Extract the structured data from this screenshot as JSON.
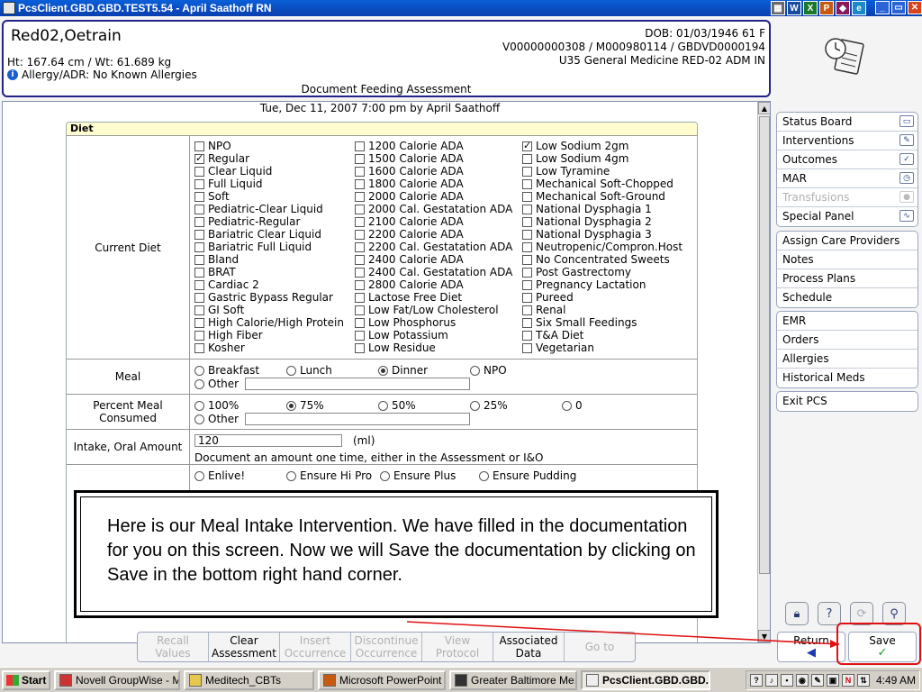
{
  "window": {
    "title": "PcsClient.GBD.GBD.TEST5.54 - April Saathoff RN",
    "tray_icons": [
      "W",
      "X",
      "P",
      "◆",
      "e"
    ],
    "minimize": "_",
    "restore": "▭",
    "close": "✕"
  },
  "patient": {
    "name": "Red02,Oetrain",
    "ht_wt": "Ht: 167.64 cm / Wt: 61.689 kg",
    "allergy": "Allergy/ADR: No Known Allergies",
    "dob": "DOB: 01/03/1946 61 F",
    "ids": "V00000000308 / M000980114 / GBDVD0000194",
    "location": "U35 General Medicine  RED-02  ADM IN",
    "screen_title": "Document Feeding Assessment"
  },
  "form": {
    "datetime": "Tue,  Dec 11, 2007 7:00 pm  by  April Saathoff",
    "section_title": "Diet",
    "current_diet_label": "Current Diet",
    "diet_col1": [
      {
        "label": "NPO",
        "checked": false
      },
      {
        "label": "Regular",
        "checked": true
      },
      {
        "label": "Clear Liquid",
        "checked": false
      },
      {
        "label": "Full Liquid",
        "checked": false
      },
      {
        "label": "Soft",
        "checked": false
      },
      {
        "label": "Pediatric-Clear Liquid",
        "checked": false
      },
      {
        "label": "Pediatric-Regular",
        "checked": false
      },
      {
        "label": "Bariatric Clear Liquid",
        "checked": false
      },
      {
        "label": "Bariatric Full Liquid",
        "checked": false
      },
      {
        "label": "Bland",
        "checked": false
      },
      {
        "label": "BRAT",
        "checked": false
      },
      {
        "label": "Cardiac 2",
        "checked": false
      },
      {
        "label": "Gastric Bypass Regular",
        "checked": false
      },
      {
        "label": "GI Soft",
        "checked": false
      },
      {
        "label": "High Calorie/High Protein",
        "checked": false
      },
      {
        "label": "High Fiber",
        "checked": false
      },
      {
        "label": "Kosher",
        "checked": false
      }
    ],
    "diet_col2": [
      {
        "label": "1200 Calorie ADA",
        "checked": false
      },
      {
        "label": "1500 Calorie ADA",
        "checked": false
      },
      {
        "label": "1600 Calorie ADA",
        "checked": false
      },
      {
        "label": "1800 Calorie ADA",
        "checked": false
      },
      {
        "label": "2000 Calorie ADA",
        "checked": false
      },
      {
        "label": "2000 Cal. Gestatation ADA",
        "checked": false
      },
      {
        "label": "2100 Calorie ADA",
        "checked": false
      },
      {
        "label": "2200 Calorie ADA",
        "checked": false
      },
      {
        "label": "2200 Cal. Gestatation ADA",
        "checked": false
      },
      {
        "label": "2400 Calorie ADA",
        "checked": false
      },
      {
        "label": "2400 Cal. Gestatation ADA",
        "checked": false
      },
      {
        "label": "2800 Calorie ADA",
        "checked": false
      },
      {
        "label": "Lactose Free Diet",
        "checked": false
      },
      {
        "label": "Low Fat/Low Cholesterol",
        "checked": false
      },
      {
        "label": "Low Phosphorus",
        "checked": false
      },
      {
        "label": "Low Potassium",
        "checked": false
      },
      {
        "label": "Low Residue",
        "checked": false
      }
    ],
    "diet_col3": [
      {
        "label": "Low Sodium 2gm",
        "checked": true
      },
      {
        "label": "Low Sodium 4gm",
        "checked": false
      },
      {
        "label": "Low Tyramine",
        "checked": false
      },
      {
        "label": "Mechanical Soft-Chopped",
        "checked": false
      },
      {
        "label": "Mechanical Soft-Ground",
        "checked": false
      },
      {
        "label": "National Dysphagia 1",
        "checked": false
      },
      {
        "label": "National Dysphagia 2",
        "checked": false
      },
      {
        "label": "National Dysphagia 3",
        "checked": false
      },
      {
        "label": "Neutropenic/Compron.Host",
        "checked": false
      },
      {
        "label": "No Concentrated Sweets",
        "checked": false
      },
      {
        "label": "Post Gastrectomy",
        "checked": false
      },
      {
        "label": "Pregnancy Lactation",
        "checked": false
      },
      {
        "label": "Pureed",
        "checked": false
      },
      {
        "label": "Renal",
        "checked": false
      },
      {
        "label": "Six Small Feedings",
        "checked": false
      },
      {
        "label": "T&A Diet",
        "checked": false
      },
      {
        "label": "Vegetarian",
        "checked": false
      }
    ],
    "meal_label": "Meal",
    "meal_options": [
      {
        "label": "Breakfast",
        "selected": false
      },
      {
        "label": "Lunch",
        "selected": false
      },
      {
        "label": "Dinner",
        "selected": true
      },
      {
        "label": "NPO",
        "selected": false
      }
    ],
    "meal_other": "Other",
    "percent_label": "Percent Meal Consumed",
    "percent_options": [
      {
        "label": "100%",
        "selected": false
      },
      {
        "label": "75%",
        "selected": true
      },
      {
        "label": "50%",
        "selected": false
      },
      {
        "label": "25%",
        "selected": false
      },
      {
        "label": "0",
        "selected": false
      }
    ],
    "percent_other": "Other",
    "intake_label": "Intake, Oral Amount",
    "intake_value": "120",
    "intake_unit": "(ml)",
    "intake_note": "Document an amount one time, either in the  Assessment or I&O",
    "supplement_options": [
      {
        "label": "Enlive!",
        "selected": false
      },
      {
        "label": "Ensure Hi Pro",
        "selected": false
      },
      {
        "label": "Ensure Plus",
        "selected": false
      },
      {
        "label": "Ensure Pudding",
        "selected": false
      }
    ]
  },
  "sidebar": {
    "group1": [
      {
        "label": "Status Board",
        "icon": "▭",
        "disabled": false
      },
      {
        "label": "Interventions",
        "icon": "✎",
        "disabled": false
      },
      {
        "label": "Outcomes",
        "icon": "✓",
        "disabled": false
      },
      {
        "label": "MAR",
        "icon": "◷",
        "disabled": false
      },
      {
        "label": "Transfusions",
        "icon": "●",
        "disabled": true
      },
      {
        "label": "Special Panel",
        "icon": "∿",
        "disabled": false
      }
    ],
    "group2": [
      {
        "label": "Assign Care Providers"
      },
      {
        "label": "Notes"
      },
      {
        "label": "Process Plans"
      },
      {
        "label": "Schedule"
      }
    ],
    "group3": [
      {
        "label": "EMR"
      },
      {
        "label": "Orders"
      },
      {
        "label": "Allergies"
      },
      {
        "label": "Historical Meds"
      }
    ],
    "group4": [
      {
        "label": "Exit PCS"
      }
    ]
  },
  "toolbar": {
    "recall_values": "Recall Values",
    "clear_assessment": "Clear Assessment",
    "insert_occurrence": "Insert Occurrence",
    "discontinue_occurrence": "Discontinue Occurrence",
    "view_protocol": "View Protocol",
    "associated_data": "Associated Data",
    "go_to": "Go to",
    "return": "Return",
    "save": "Save"
  },
  "callout": {
    "text": "Here is our Meal Intake Intervention. We have filled in the documentation for you on this screen. Now we will Save the documentation by clicking on Save in the bottom right hand corner."
  },
  "taskbar": {
    "start": "Start",
    "tasks": [
      {
        "label": "Novell GroupWise - M...",
        "active": false
      },
      {
        "label": "Meditech_CBTs",
        "active": false
      },
      {
        "label": "Microsoft PowerPoint ...",
        "active": false
      },
      {
        "label": "Greater Baltimore Me...",
        "active": false
      },
      {
        "label": "PcsClient.GBD.GBD....",
        "active": true
      }
    ],
    "time": "4:49 AM"
  }
}
